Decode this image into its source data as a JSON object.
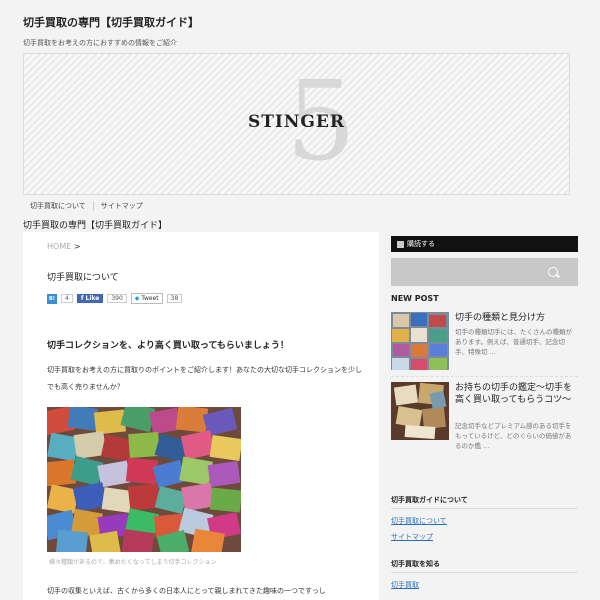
{
  "site": {
    "title": "切手買取の専門【切手買取ガイド】",
    "description": "切手買取をお考えの方におすすめの情報をご紹介",
    "logo_text": "STINGER",
    "logo_mark": "5"
  },
  "nav": {
    "items": [
      "切手買取について",
      "サイトマップ"
    ]
  },
  "page_heading": "切手買取の専門【切手買取ガイド】",
  "main": {
    "breadcrumb_home": "HOME",
    "breadcrumb_sep": ">",
    "post_title": "切手買取について",
    "share": {
      "hatena_label": "B!",
      "hatena_count": "4",
      "like_label": "Like",
      "like_count": "390",
      "tweet_label": "Tweet",
      "tweet_count": "38"
    },
    "lead": "切手コレクションを、より高く買い取ってもらいましょう！",
    "intro": "切手買取をお考えの方に買取りのポイントをご紹介します！あなたの大切な切手コレクションを少しでも高く売りませんか？",
    "photo_caption": "様々種類があるので、集めたくなってしまう切手コレクション",
    "body_start": "切手の収集といえば、古くから多くの日本人にとって親しまれてきた趣味の一つですっし"
  },
  "sidebar": {
    "rss_label": "購読する",
    "search_icon": "magnifier-icon",
    "new_post_label": "NEW POST",
    "new_posts": [
      {
        "title": "切手の種類と見分け方",
        "excerpt": "切手の種類切手には、たくさんの種類があります。例えば、普通切手、記念切手、特殊切 ..."
      },
      {
        "title": "お持ちの切手の鑑定～切手を高く買い取ってもらうコツ～",
        "excerpt": "記念切手などプレミアム感のある切手をもっているけど、どのぐらいの価値があるのか鑑 ..."
      }
    ],
    "widgets": [
      {
        "heading": "切手買取ガイドについて",
        "links": [
          "切手買取について",
          "サイトマップ"
        ]
      },
      {
        "heading": "切手買取を知る",
        "links": [
          "切手買取"
        ]
      }
    ]
  },
  "colors": {
    "background": "#f3f3f3",
    "link": "#2a6ebb",
    "rss_bar": "#111111",
    "search_bar": "#c8c8c8",
    "like_blue": "#4267b2",
    "hatena_blue": "#3a8fd9"
  }
}
